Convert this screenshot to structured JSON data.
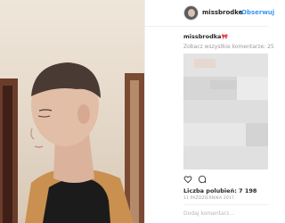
{
  "post": {
    "username": "missbrodka",
    "separator": "•",
    "follow_label": "Obserwuj",
    "caption": {
      "user": "missbrodka",
      "emoji": "🎀"
    },
    "view_all_comments": "Zobacz wszystkie komentarze: 25",
    "likes_text": "Liczba polubień: 7 198",
    "date": "11 PAŹDZIERNIKA 2017",
    "add_comment_placeholder": "Dodaj komentarz...",
    "icons": {
      "like": "heart-icon",
      "comment": "comment-icon"
    }
  }
}
